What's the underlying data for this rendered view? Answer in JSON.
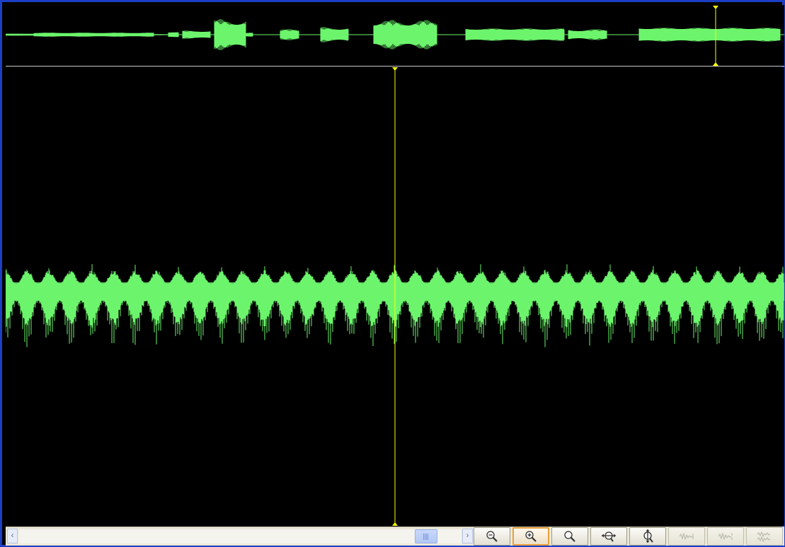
{
  "window": {
    "frame_color": "#1c3fc4",
    "background": "#000000"
  },
  "waveform": {
    "wave_color": "#6cf56c",
    "cursor_color": "#ffff00",
    "divider_color": "#c8c8c8"
  },
  "overview": {
    "cursor_position_fraction": 0.912
  },
  "main_view": {
    "cursor_position_fraction": 0.5
  },
  "scrollbar": {
    "left_arrow_icon": "scroll-left-arrow",
    "right_arrow_icon": "scroll-right-arrow",
    "thumb_position_fraction": 0.93
  },
  "toolbar": {
    "buttons": [
      {
        "icon": "zoom-out-icon",
        "state": "normal"
      },
      {
        "icon": "zoom-in-icon",
        "state": "active"
      },
      {
        "icon": "zoom-icon",
        "state": "normal"
      },
      {
        "icon": "fit-horizontal-icon",
        "state": "normal"
      },
      {
        "icon": "fit-vertical-icon",
        "state": "normal"
      },
      {
        "icon": "waveform-view-1-icon",
        "state": "disabled"
      },
      {
        "icon": "waveform-view-2-icon",
        "state": "disabled"
      },
      {
        "icon": "waveform-view-3-icon",
        "state": "disabled"
      }
    ]
  }
}
